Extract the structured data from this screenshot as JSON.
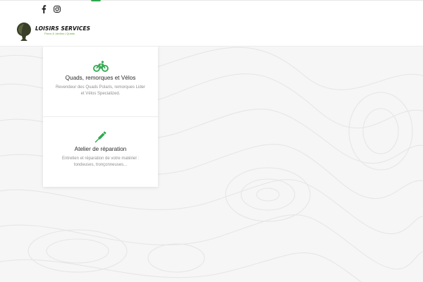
{
  "header": {
    "social": [
      {
        "icon": "facebook-icon"
      },
      {
        "icon": "instagram-icon"
      }
    ],
    "logo": {
      "name": "LOISIRS SERVICES",
      "tagline": "Parcs & Jardins | Quads"
    }
  },
  "services": [
    {
      "icon": "bicycle-icon",
      "title": "Quads, remorques et Vélos",
      "description": "Revendeur des Quads Polaris, remorques Lider et Vélos Specialized."
    },
    {
      "icon": "screwdriver-icon",
      "title": "Atelier de réparation",
      "description": "Entretien et réparation de votre matériel : tondeuses, tronçonneuses..."
    }
  ],
  "colors": {
    "accent": "#2fa84f",
    "background": "#f6f6f6",
    "card": "#ffffff"
  }
}
